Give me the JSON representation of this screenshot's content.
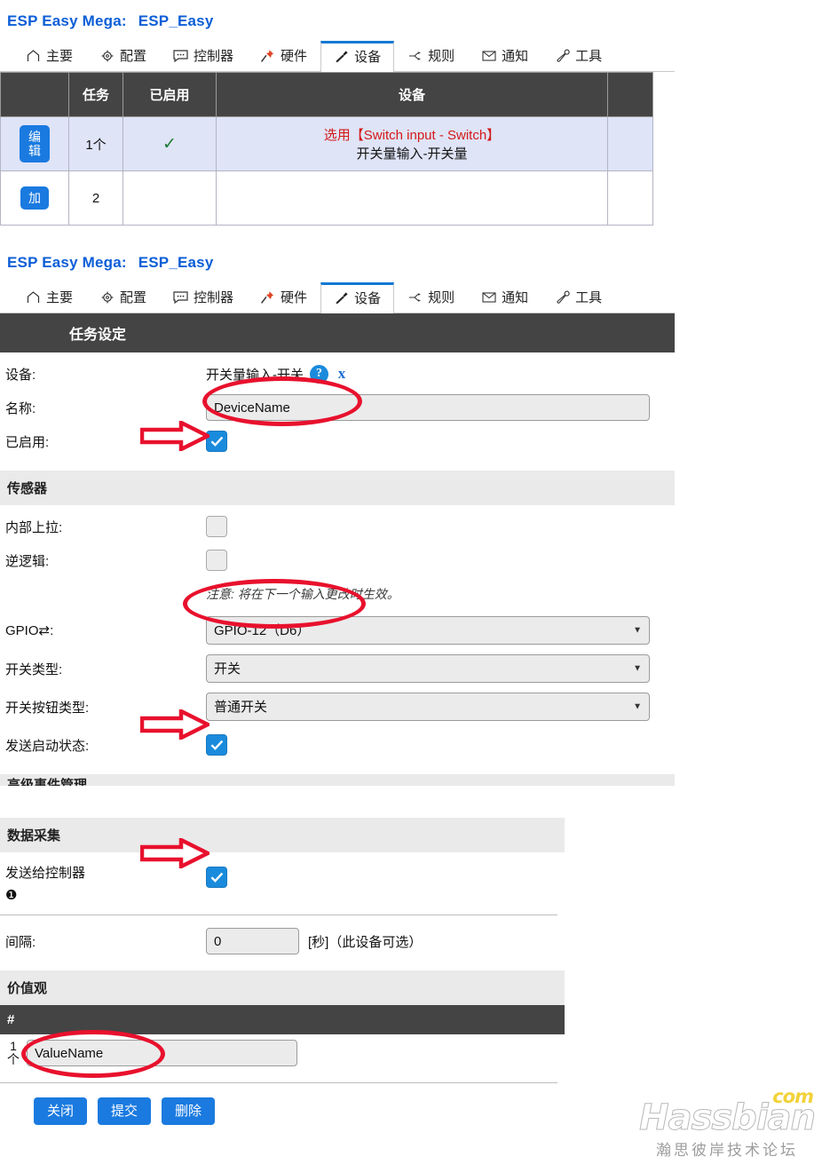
{
  "app": {
    "title_main": "ESP Easy Mega:",
    "title_device": "ESP_Easy"
  },
  "tabs": [
    {
      "label": "主要",
      "icon": "home-icon",
      "active": false
    },
    {
      "label": "配置",
      "icon": "gear-icon",
      "active": false
    },
    {
      "label": "控制器",
      "icon": "speech-bubble-icon",
      "active": false
    },
    {
      "label": "硬件",
      "icon": "pushpin-icon",
      "active": false
    },
    {
      "label": "设备",
      "icon": "plug-icon",
      "active": true
    },
    {
      "label": "规则",
      "icon": "branch-icon",
      "active": false
    },
    {
      "label": "通知",
      "icon": "envelope-icon",
      "active": false
    },
    {
      "label": "工具",
      "icon": "wrench-icon",
      "active": false
    }
  ],
  "devices_table": {
    "headers": [
      "",
      "任务",
      "已启用",
      "设备",
      ""
    ],
    "rows": [
      {
        "button": "编辑",
        "task": "1个",
        "enabled": "✓",
        "device_select": "选用【Switch input - Switch】",
        "device_name": "开关量输入-开关量",
        "filled": true
      },
      {
        "button": "加",
        "task": "2",
        "enabled": "",
        "device_select": "",
        "device_name": "",
        "filled": false
      }
    ]
  },
  "task_settings": {
    "section_title": "任务设定",
    "device": {
      "label": "设备:",
      "value": "开关量输入-开关",
      "help_icon": "question-circle-icon",
      "info_icon": "info-icon"
    },
    "name": {
      "label": "名称:",
      "value": "DeviceName",
      "placeholder": ""
    },
    "enabled": {
      "label": "已启用:",
      "checked": true
    },
    "sensor": {
      "section": "传感器",
      "internal_pullup": {
        "label": "内部上拉:",
        "checked": false
      },
      "inverse_logic": {
        "label": "逆逻辑:",
        "checked": false
      },
      "note": "注意: 将在下一个输入更改时生效。",
      "gpio": {
        "label": "GPIO⇄:",
        "value": "GPIO-12（D6）"
      },
      "switch_type": {
        "label": "开关类型:",
        "value": "开关"
      },
      "button_type": {
        "label": "开关按钮类型:",
        "value": "普通开关"
      },
      "send_boot_state": {
        "label": "发送启动状态:",
        "checked": true
      }
    },
    "advanced_section": "高级事件管理",
    "data_acquisition": {
      "section": "数据采集",
      "send_to_controller": {
        "label": "发送给控制器",
        "badge": "❶",
        "checked": true
      },
      "interval": {
        "label": "间隔:",
        "value": "0",
        "unit_hint": "[秒]（此设备可选）"
      }
    },
    "values": {
      "section": "价值观",
      "column_header": "#",
      "rows": [
        {
          "index": "1",
          "index_unit": "个",
          "value": "ValueName"
        }
      ]
    },
    "buttons": [
      {
        "label": "关闭",
        "name": "close-button"
      },
      {
        "label": "提交",
        "name": "submit-button"
      },
      {
        "label": "删除",
        "name": "delete-button"
      }
    ]
  },
  "watermark": {
    "main": "Hassbian",
    "suffix": "com",
    "sub": "瀚思彼岸技术论坛"
  },
  "colors": {
    "accent_blue": "#1a7ae0",
    "header_dark": "#444444",
    "annotation_red": "#e8112d",
    "link_blue": "#0b5ed7",
    "alert_red": "#d41818"
  }
}
